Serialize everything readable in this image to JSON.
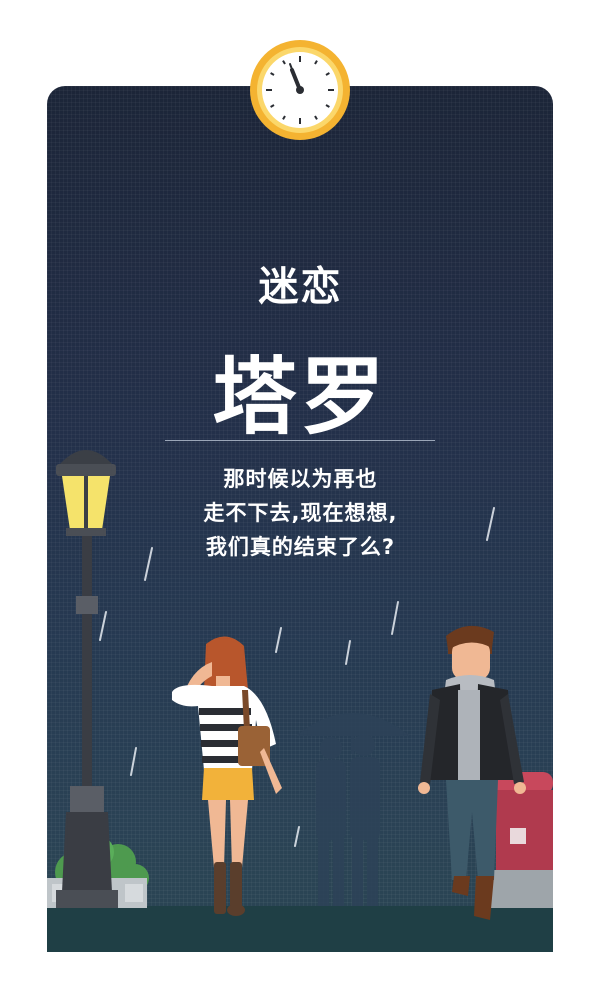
{
  "poster": {
    "subtitle": "迷恋",
    "title": "塔罗",
    "lines": [
      "那时候以为再也",
      "走不下去,现在想想,",
      "我们真的结束了么?"
    ]
  },
  "colors": {
    "background_top": "#1c2538",
    "background_bottom": "#2a4653",
    "clock_rim": "#f4b331",
    "text": "#ffffff"
  },
  "icons": [
    "clock-icon",
    "street-lamp",
    "umbrella-silhouette",
    "mailbox"
  ]
}
